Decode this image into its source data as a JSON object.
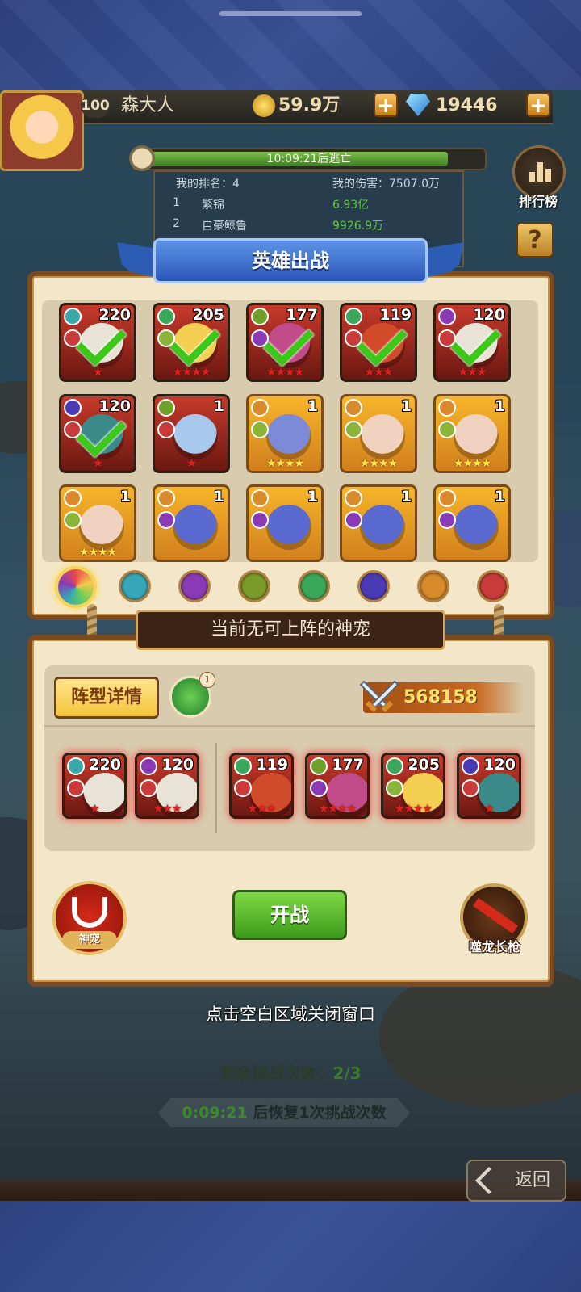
{
  "player": {
    "level": "100",
    "name": "森大人",
    "gold": "59.9万",
    "gems": "19446"
  },
  "boss_timer": {
    "text": "10:09:21后逃亡",
    "progress": 0.92
  },
  "ranking": {
    "my_rank": "我的排名：4",
    "my_damage": "我的伤害：7507.0万",
    "rows": [
      {
        "rank": "1",
        "name": "繁锦",
        "value": "6.93亿"
      },
      {
        "rank": "2",
        "name": "自豪鲸鲁",
        "value": "9926.9万"
      }
    ]
  },
  "side_buttons": {
    "leaderboard": "排行榜",
    "help": "?"
  },
  "panel_title": "英雄出战",
  "heroes": [
    {
      "level": "220",
      "stars": "★",
      "checked": true,
      "frame": "red",
      "face": "#e9e2d6",
      "c1": "#3aa7a8",
      "c2": "#c93a3a"
    },
    {
      "level": "205",
      "stars": "★★★★",
      "checked": true,
      "frame": "red",
      "face": "#f4cf52",
      "c1": "#3aa75a",
      "c2": "#8bb53a"
    },
    {
      "level": "177",
      "stars": "★★★★",
      "checked": true,
      "frame": "red",
      "face": "#c24b8a",
      "c1": "#6fa02a",
      "c2": "#8a3ab5"
    },
    {
      "level": "119",
      "stars": "★★★",
      "checked": true,
      "frame": "red",
      "face": "#d14a2a",
      "c1": "#3aa75a",
      "c2": "#c93a3a"
    },
    {
      "level": "120",
      "stars": "★★★",
      "checked": true,
      "frame": "red",
      "face": "#e9e2d6",
      "c1": "#8a3ab5",
      "c2": "#c93a3a"
    },
    {
      "level": "120",
      "stars": "★",
      "checked": true,
      "frame": "red",
      "face": "#3a8a8a",
      "c1": "#4a3ab5",
      "c2": "#c93a3a"
    },
    {
      "level": "1",
      "stars": "★",
      "checked": false,
      "frame": "red",
      "face": "#a8c8ee",
      "c1": "#6fa02a",
      "c2": "#c93a3a"
    },
    {
      "level": "1",
      "stars": "★★★★",
      "checked": false,
      "frame": "gold",
      "face": "#7d8ad8",
      "c1": "#d98a2a",
      "c2": "#8bb53a"
    },
    {
      "level": "1",
      "stars": "★★★★",
      "checked": false,
      "frame": "gold",
      "face": "#f1d2c0",
      "c1": "#d98a2a",
      "c2": "#8bb53a"
    },
    {
      "level": "1",
      "stars": "★★★★",
      "checked": false,
      "frame": "gold",
      "face": "#f1d2c0",
      "c1": "#d98a2a",
      "c2": "#8bb53a"
    },
    {
      "level": "1",
      "stars": "★★★★",
      "checked": false,
      "frame": "gold",
      "face": "#f1d2c0",
      "c1": "#d98a2a",
      "c2": "#8bb53a"
    },
    {
      "level": "1",
      "stars": "",
      "checked": false,
      "frame": "gold",
      "face": "#5b6ad0",
      "c1": "#d98a2a",
      "c2": "#8a3ab5"
    },
    {
      "level": "1",
      "stars": "",
      "checked": false,
      "frame": "gold",
      "face": "#5b6ad0",
      "c1": "#d98a2a",
      "c2": "#8a3ab5"
    },
    {
      "level": "1",
      "stars": "",
      "checked": false,
      "frame": "gold",
      "face": "#5b6ad0",
      "c1": "#d98a2a",
      "c2": "#8a3ab5"
    },
    {
      "level": "1",
      "stars": "",
      "checked": false,
      "frame": "gold",
      "face": "#5b6ad0",
      "c1": "#d98a2a",
      "c2": "#8a3ab5"
    }
  ],
  "element_filters": [
    {
      "name": "all-filter",
      "color": "conic"
    },
    {
      "name": "water-filter",
      "color": "#35a7b8"
    },
    {
      "name": "shadow-filter",
      "color": "#8a3ab5"
    },
    {
      "name": "nature-filter",
      "color": "#7a9a2a"
    },
    {
      "name": "leaf-filter",
      "color": "#3aa75a"
    },
    {
      "name": "dark-filter",
      "color": "#4a3ab5"
    },
    {
      "name": "light-filter",
      "color": "#d98a2a"
    },
    {
      "name": "fire-filter",
      "color": "#c93a3a"
    }
  ],
  "no_pet_message": "当前无可上阵的神宠",
  "formation": {
    "details_label": "阵型详情",
    "pet_badge": "1",
    "power": "568158",
    "front": [
      {
        "level": "220",
        "stars": "★",
        "face": "#e9e2d6",
        "c1": "#3aa7a8",
        "c2": "#c93a3a"
      },
      {
        "level": "120",
        "stars": "★★★",
        "face": "#e9e2d6",
        "c1": "#8a3ab5",
        "c2": "#c93a3a"
      }
    ],
    "back": [
      {
        "level": "119",
        "stars": "★★★",
        "face": "#d14a2a",
        "c1": "#3aa75a",
        "c2": "#c93a3a"
      },
      {
        "level": "177",
        "stars": "★★★★",
        "face": "#c24b8a",
        "c1": "#6fa02a",
        "c2": "#8a3ab5"
      },
      {
        "level": "205",
        "stars": "★★★★",
        "face": "#f4cf52",
        "c1": "#3aa75a",
        "c2": "#8bb53a"
      },
      {
        "level": "120",
        "stars": "★",
        "face": "#3a8a8a",
        "c1": "#4a3ab5",
        "c2": "#c93a3a"
      }
    ]
  },
  "pet_button_label": "神宠",
  "start_label": "开战",
  "weapon_label": "噬龙长枪",
  "close_hint": "点击空白区域关闭窗口",
  "remaining": {
    "label": "剩余挑战次数：",
    "value": "2/3"
  },
  "recover": {
    "time": "0:09:21",
    "text": " 后恢复1次挑战次数"
  },
  "back_label": "返回"
}
